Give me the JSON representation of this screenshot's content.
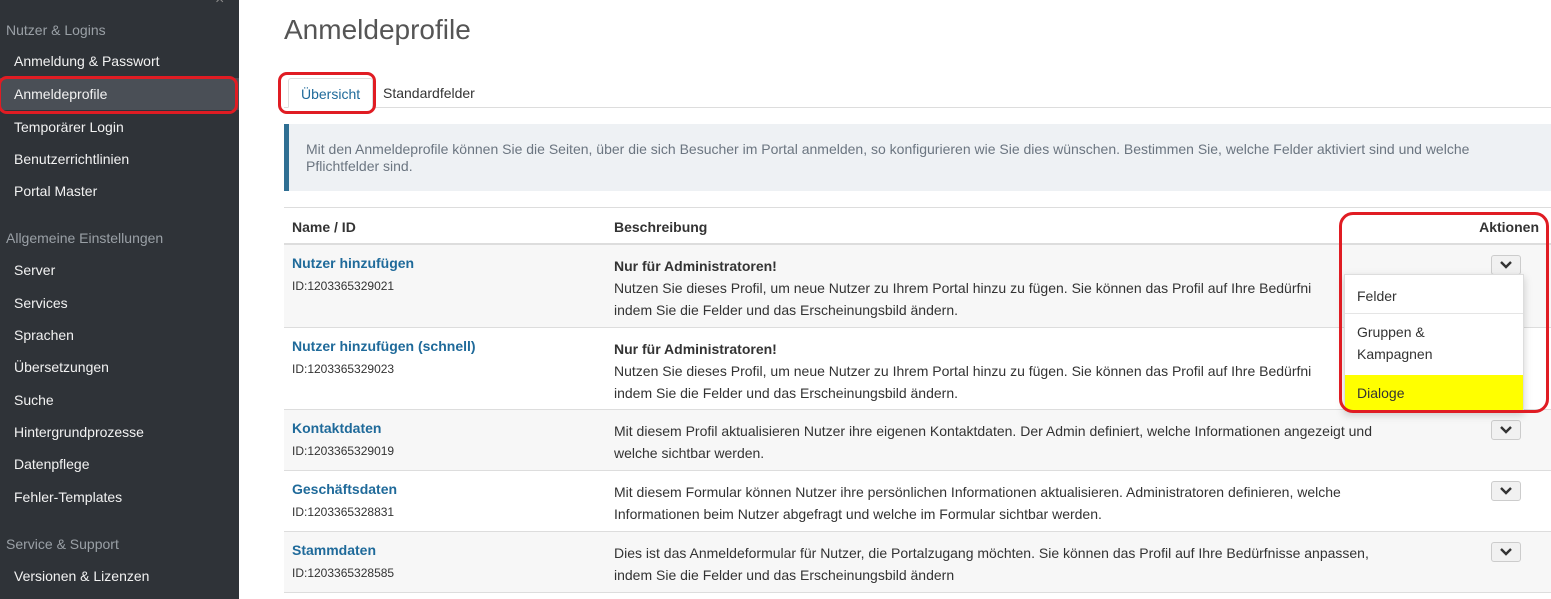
{
  "sidebar": {
    "close_glyph": "×",
    "sections": [
      {
        "label": "Nutzer & Logins"
      },
      {
        "label": "Allgemeine Einstellungen"
      },
      {
        "label": "Service & Support"
      }
    ],
    "items": [
      {
        "label": "Anmeldung & Passwort"
      },
      {
        "label": "Anmeldeprofile",
        "active": true
      },
      {
        "label": "Temporärer Login"
      },
      {
        "label": "Benutzerrichtlinien"
      },
      {
        "label": "Portal Master"
      },
      {
        "label": "Server"
      },
      {
        "label": "Services"
      },
      {
        "label": "Sprachen"
      },
      {
        "label": "Übersetzungen"
      },
      {
        "label": "Suche"
      },
      {
        "label": "Hintergrundprozesse"
      },
      {
        "label": "Datenpflege"
      },
      {
        "label": "Fehler-Templates"
      },
      {
        "label": "Versionen & Lizenzen"
      }
    ]
  },
  "main": {
    "title": "Anmeldeprofile",
    "tabs": [
      {
        "label": "Übersicht",
        "active": true
      },
      {
        "label": "Standardfelder"
      }
    ],
    "info_text": "Mit den Anmeldeprofile können Sie die Seiten, über die sich Besucher im Portal anmelden, so konfigurieren wie Sie dies wünschen. Bestimmen Sie, welche Felder aktiviert sind und welche Pflichtfelder sind.",
    "table": {
      "headers": {
        "name": "Name / ID",
        "desc": "Beschreibung",
        "actions": "Aktionen"
      },
      "rows": [
        {
          "name": "Nutzer hinzufügen",
          "id": "ID:1203365329021",
          "desc_title": "Nur für Administratoren!",
          "desc": "Nutzen Sie dieses Profil, um neue Nutzer zu Ihrem Portal hinzu zu fügen. Sie können das Profil auf Ihre Bedürfni",
          "desc2": "indem Sie die Felder und das Erscheinungsbild ändern."
        },
        {
          "name": "Nutzer hinzufügen (schnell)",
          "id": "ID:1203365329023",
          "desc_title": "Nur für Administratoren!",
          "desc": "Nutzen Sie dieses Profil, um neue Nutzer zu Ihrem Portal hinzu zu fügen. Sie können das Profil auf Ihre Bedürfni",
          "desc2": "indem Sie die Felder und das Erscheinungsbild ändern."
        },
        {
          "name": "Kontaktdaten",
          "id": "ID:1203365329019",
          "desc": "Mit diesem Profil aktualisieren Nutzer ihre eigenen Kontaktdaten. Der Admin definiert, welche Informationen angezeigt und",
          "desc2": "welche sichtbar werden."
        },
        {
          "name": "Geschäftsdaten",
          "id": "ID:1203365328831",
          "desc": "Mit diesem Formular können Nutzer ihre persönlichen Informationen aktualisieren. Administratoren definieren, welche",
          "desc2": "Informationen beim Nutzer abgefragt und welche im Formular sichtbar werden."
        },
        {
          "name": "Stammdaten",
          "id": "ID:1203365328585",
          "desc": "Dies ist das Anmeldeformular für Nutzer, die Portalzugang möchten. Sie können das Profil auf Ihre Bedürfnisse anpassen,",
          "desc2": "indem Sie die Felder und das Erscheinungsbild ändern"
        }
      ]
    },
    "dropdown": {
      "items": [
        {
          "label": "Felder"
        },
        {
          "label": "Gruppen &",
          "label2": "Kampagnen"
        },
        {
          "label": "Dialoge",
          "selected": true
        }
      ]
    }
  },
  "colors": {
    "sidebar_bg": "#2f3338",
    "link": "#1f6a9a",
    "annotation_red": "#e01c23",
    "highlight_yellow": "#ffff00"
  }
}
